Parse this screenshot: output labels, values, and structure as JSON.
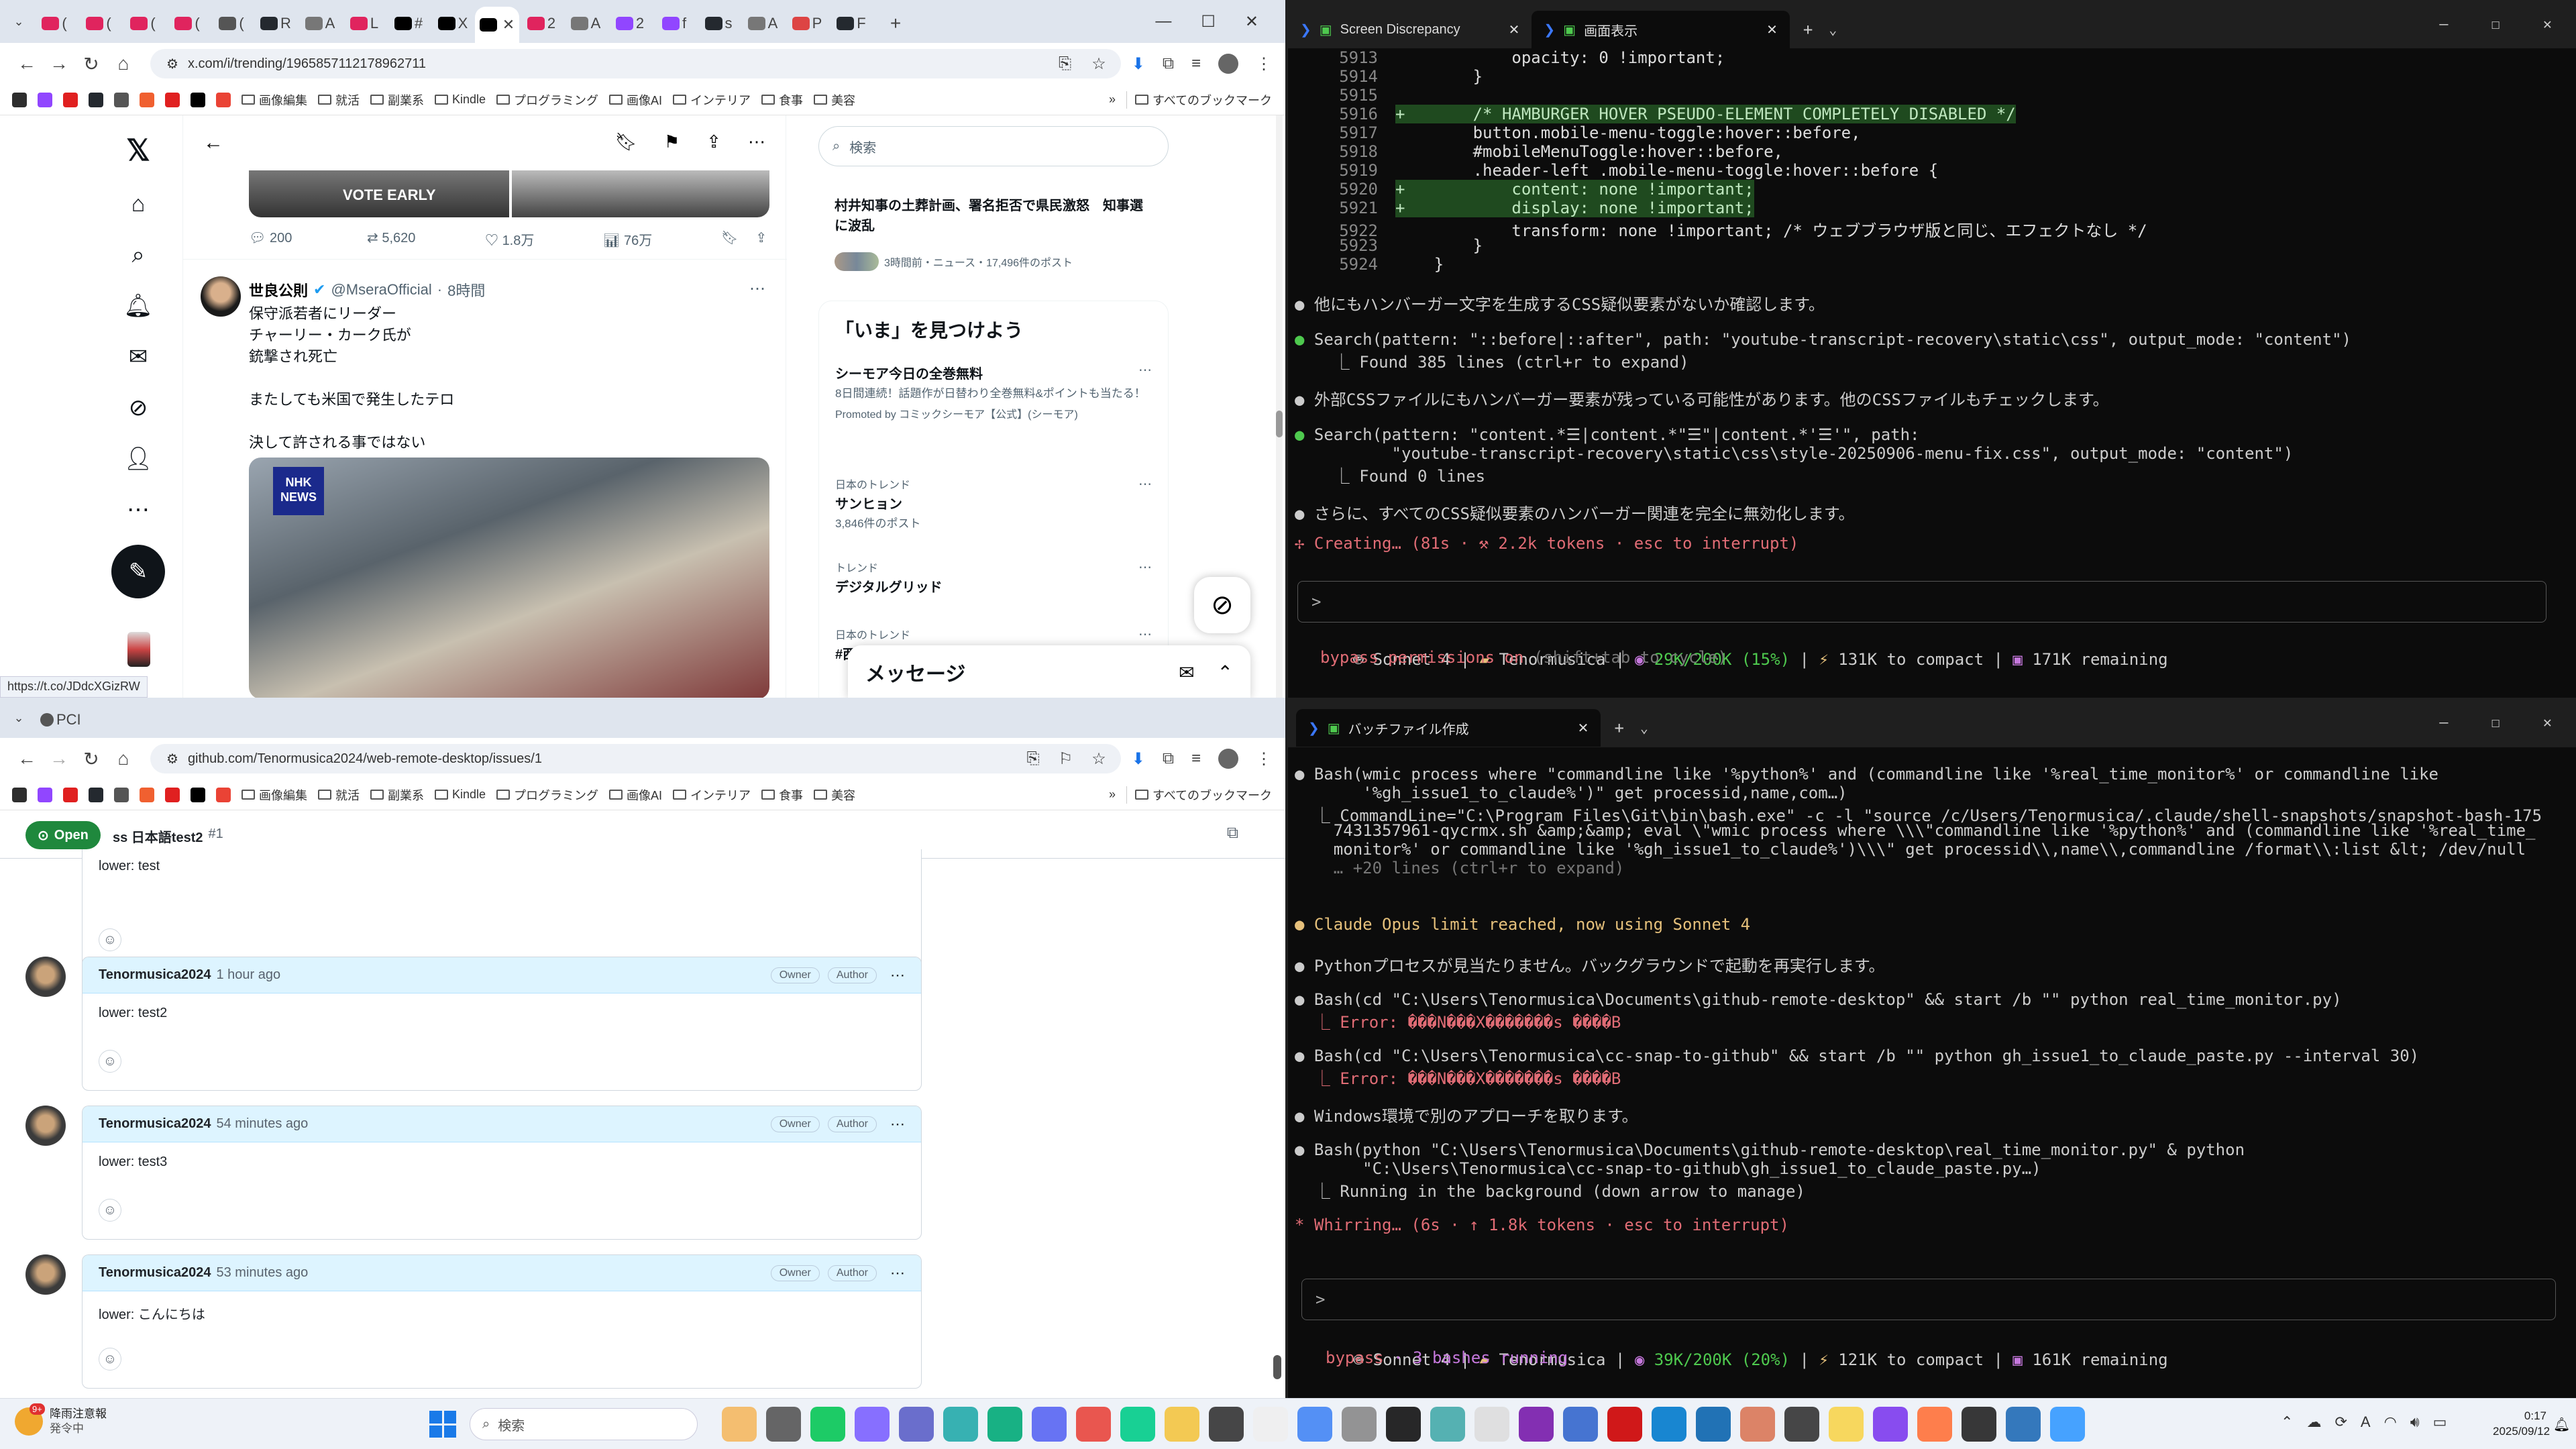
{
  "layout": "4-tiled-windows",
  "xwin": {
    "tabs": [
      {
        "t": "(",
        "c": "#e0245e"
      },
      {
        "t": "(",
        "c": "#e0245e"
      },
      {
        "t": "(",
        "c": "#e0245e"
      },
      {
        "t": "(",
        "c": "#e0245e"
      },
      {
        "t": "(",
        "c": "#555"
      },
      {
        "t": "R",
        "c": "#24292f"
      },
      {
        "t": "A",
        "c": "#777"
      },
      {
        "t": "L",
        "c": "#e0245e"
      },
      {
        "t": "#",
        "c": "#000"
      },
      {
        "t": "X",
        "c": "#000"
      },
      {
        "t": "",
        "c": "#000",
        "active": true
      },
      {
        "t": "2",
        "c": "#e0245e"
      },
      {
        "t": "A",
        "c": "#777"
      },
      {
        "t": "2",
        "c": "#9146ff"
      },
      {
        "t": "f",
        "c": "#9146ff"
      },
      {
        "t": "s",
        "c": "#24292f"
      },
      {
        "t": "A",
        "c": "#777"
      },
      {
        "t": "P",
        "c": "#d44"
      },
      {
        "t": "F",
        "c": "#24292f"
      }
    ],
    "url": "x.com/i/trending/1965857112178962711",
    "bookmarks": [
      "画像編集",
      "就活",
      "副業系",
      "Kindle",
      "プログラミング",
      "画像AI",
      "インテリア",
      "食事",
      "美容"
    ],
    "all_bookmarks": "すべてのブックマーク",
    "tweet1": {
      "replies": "200",
      "retweets": "5,620",
      "likes": "1.8万",
      "views": "76万",
      "image_caption": "VOTE EARLY"
    },
    "tweet2": {
      "name": "世良公則",
      "handle": "@MseraOfficial",
      "time": "8時間",
      "lines": [
        "保守派若者にリーダー",
        "チャーリー・カーク氏が",
        "銃撃され死亡",
        "",
        "またしても米国で発生したテロ",
        "",
        "決して許される事ではない"
      ],
      "image_badge": "NHK\nNEWS"
    },
    "search_placeholder": "検索",
    "news": {
      "title": "村井知事の土葬計画、署名拒否で県民激怒　知事選に波乱",
      "meta": "3時間前・ニュース・17,496件のポスト"
    },
    "explore_title": "「いま」を見つけよう",
    "trends": [
      {
        "kicker": "",
        "title": "シーモア今日の全巻無料",
        "desc": "8日間連続！話題作が日替わり全巻無料&ポイントも当たる！",
        "promo": "Promoted by コミックシーモア【公式】(シーモア)"
      },
      {
        "kicker": "日本のトレンド",
        "title": "サンヒョン",
        "desc": "3,846件のポスト"
      },
      {
        "kicker": "トレンド",
        "title": "デジタルグリッド",
        "desc": ""
      },
      {
        "kicker": "日本のトレンド",
        "title": "#西…",
        "desc": ""
      }
    ],
    "messages": "メッセージ",
    "statusbar": "https://t.co/JDdcXGizRW"
  },
  "ghwin": {
    "tab_text": "PCI",
    "url": "github.com/Tenormusica2024/web-remote-desktop/issues/1",
    "issue": {
      "state": "Open",
      "title": "ss 日本語test2",
      "number": "#1"
    },
    "first_body": "lower: test",
    "comments": [
      {
        "author": "Tenormusica2024",
        "time": "1 hour ago",
        "body": "lower: test2"
      },
      {
        "author": "Tenormusica2024",
        "time": "54 minutes ago",
        "body": "lower: test3"
      },
      {
        "author": "Tenormusica2024",
        "time": "53 minutes ago",
        "body": "lower: こんにちは"
      }
    ],
    "owner": "Owner",
    "author_badge": "Author"
  },
  "term1": {
    "tabs": [
      "Screen Discrepancy",
      "画面表示"
    ],
    "diff": [
      {
        "n": "5913",
        "t": "            opacity: 0 !important;",
        "g": false
      },
      {
        "n": "5914",
        "t": "        }",
        "g": false
      },
      {
        "n": "5915",
        "t": "",
        "g": false
      },
      {
        "n": "5916",
        "t": "+       /* HAMBURGER HOVER PSEUDO-ELEMENT COMPLETELY DISABLED */",
        "g": true
      },
      {
        "n": "5917",
        "t": "        button.mobile-menu-toggle:hover::before,",
        "g": false
      },
      {
        "n": "5918",
        "t": "        #mobileMenuToggle:hover::before,",
        "g": false
      },
      {
        "n": "5919",
        "t": "        .header-left .mobile-menu-toggle:hover::before {",
        "g": false
      },
      {
        "n": "5920",
        "t": "+           content: none !important;",
        "g": true
      },
      {
        "n": "5921",
        "t": "+           display: none !important;",
        "g": true
      },
      {
        "n": "5922",
        "t": "            transform: none !important; /* ウェブブラウザ版と同じ、エフェクトなし */",
        "g": false
      },
      {
        "n": "5923",
        "t": "        }",
        "g": false
      },
      {
        "n": "5924",
        "t": "    }",
        "g": false
      }
    ],
    "msgs": [
      "他にもハンバーガー文字を生成するCSS疑似要素がないか確認します。",
      "Search(pattern: \"::before|::after\", path: \"youtube-transcript-recovery\\static\\css\", output_mode: \"content\")",
      "  ⎿ Found 385 lines (ctrl+r to expand)",
      "外部CSSファイルにもハンバーガー要素が残っている可能性があります。他のCSSファイルもチェックします。",
      "Search(pattern: \"content.*☰|content.*\"☰\"|content.*'☰'\", path:",
      "        \"youtube-transcript-recovery\\static\\css\\style-20250906-menu-fix.css\", output_mode: \"content\")",
      "  ⎿ Found 0 lines",
      "さらに、すべてのCSS疑似要素のハンバーガー関連を完全に無効化します。"
    ],
    "spinner": "✢ Creating… (81s · ⚒ 2.2k tokens · esc to interrupt)",
    "status": {
      "model": "Sonnet 4",
      "dir": "Tenormusica",
      "ctx": "29K/200K (15%)",
      "compact": "131K to compact",
      "remain": "171K remaining"
    },
    "perm": "bypass permissions on",
    "perm_hint": "(shift+tab to cycle)"
  },
  "term2": {
    "tab": "バッチファイル作成",
    "lines": [
      {
        "t": "● Bash(wmic process where \"commandline like '%python%' and (commandline like '%real_time_monitor%' or commandline like",
        "c": "#ccc",
        "b": "#4ec94e"
      },
      {
        "t": "       '%gh_issue1_to_claude%')\" get processid,name,com…)",
        "c": "#ccc"
      },
      {
        "t": "  ⎿ CommandLine=\"C:\\Program Files\\Git\\bin\\bash.exe\" -c -l \"source /c/Users/Tenormusica/.claude/shell-snapshots/snapshot-bash-175",
        "c": "#ccc"
      },
      {
        "t": "    7431357961-qycrmx.sh &amp;&amp; eval \\\"wmic process where \\\\\\\"commandline like '%python%' and (commandline like '%real_time_",
        "c": "#ccc"
      },
      {
        "t": "    monitor%' or commandline like '%gh_issue1_to_claude%')\\\\\\\" get processid\\\\,name\\\\,commandline /format\\\\:list &lt; /dev/null",
        "c": "#ccc"
      },
      {
        "t": "    … +20 lines (ctrl+r to expand)",
        "c": "#777"
      },
      {
        "t": "",
        "c": "#ccc"
      },
      {
        "t": "",
        "c": "#ccc"
      },
      {
        "t": "● Claude Opus limit reached, now using Sonnet 4",
        "c": "#e5c07b",
        "b": "#e5c07b"
      },
      {
        "t": "",
        "c": "#ccc"
      },
      {
        "t": "● Pythonプロセスが見当たりません。バックグラウンドで起動を再実行します。",
        "c": "#ccc",
        "b": "#ccc"
      },
      {
        "t": "",
        "c": "#ccc"
      },
      {
        "t": "● Bash(cd \"C:\\Users\\Tenormusica\\Documents\\github-remote-desktop\" && start /b \"\" python real_time_monitor.py)",
        "c": "#ccc",
        "b": "#e06c75"
      },
      {
        "t": "  ⎿ Error: ���N���X�������s ����B",
        "c": "#e06c75"
      },
      {
        "t": "",
        "c": "#ccc"
      },
      {
        "t": "● Bash(cd \"C:\\Users\\Tenormusica\\cc-snap-to-github\" && start /b \"\" python gh_issue1_to_claude_paste.py --interval 30)",
        "c": "#ccc",
        "b": "#e06c75"
      },
      {
        "t": "  ⎿ Error: ���N���X�������s ����B",
        "c": "#e06c75"
      },
      {
        "t": "",
        "c": "#ccc"
      },
      {
        "t": "● Windows環境で別のアプローチを取ります。",
        "c": "#ccc",
        "b": "#ccc"
      },
      {
        "t": "",
        "c": "#ccc"
      },
      {
        "t": "● Bash(python \"C:\\Users\\Tenormusica\\Documents\\github-remote-desktop\\real_time_monitor.py\" & python",
        "c": "#ccc",
        "b": "#4ec94e"
      },
      {
        "t": "       \"C:\\Users\\Tenormusica\\cc-snap-to-github\\gh_issue1_to_claude_paste.py…)",
        "c": "#ccc"
      },
      {
        "t": "  ⎿ Running in the background (down arrow to manage)",
        "c": "#ccc"
      },
      {
        "t": "",
        "c": "#ccc"
      },
      {
        "t": "* Whirring… (6s · ↑ 1.8k tokens · esc to interrupt)",
        "c": "#e06c75"
      }
    ],
    "status": {
      "model": "Sonnet 4",
      "dir": "Tenormusica",
      "ctx": "39K/200K (20%)",
      "compact": "121K to compact",
      "remain": "161K remaining"
    },
    "perm": "bypass",
    "perm_hint": "· 3 bashes running"
  },
  "taskbar": {
    "weather_title": "降雨注意報",
    "weather_sub": "発令中",
    "weather_badge": "9+",
    "search": "検索",
    "time": "0:17",
    "date": "2025/09/12"
  },
  "colors": {
    "accent_blue": "#1d9bf0",
    "gh_green": "#1f883d",
    "term_green": "#4ec94e",
    "term_orange": "#e5c07b",
    "term_red": "#e06c75",
    "ctx_purple": "#c678dd"
  }
}
